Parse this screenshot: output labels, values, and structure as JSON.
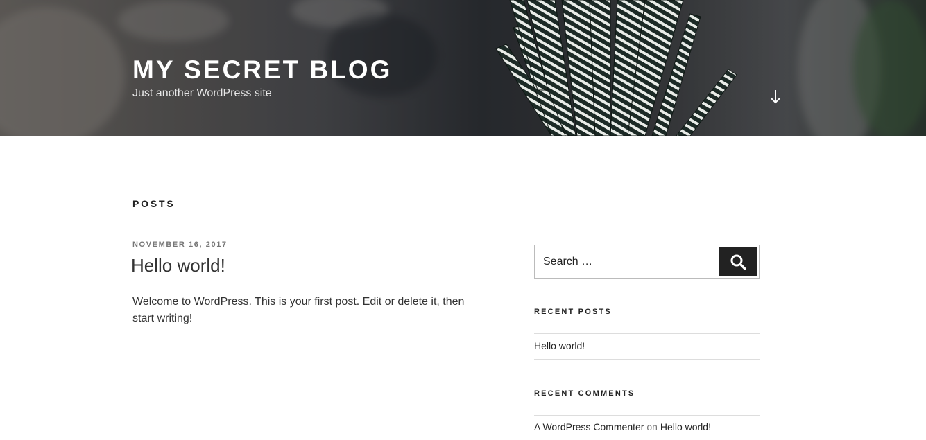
{
  "header": {
    "site_title": "MY SECRET BLOG",
    "tagline": "Just another WordPress site",
    "scroll_icon": "arrow-down-icon"
  },
  "main": {
    "heading": "POSTS",
    "posts": [
      {
        "date": "NOVEMBER 16, 2017",
        "title": "Hello world!",
        "excerpt": "Welcome to WordPress. This is your first post. Edit or delete it, then start writing!"
      }
    ]
  },
  "sidebar": {
    "search": {
      "placeholder": "Search …",
      "button_icon": "search-icon"
    },
    "recent_posts": {
      "title": "RECENT POSTS",
      "items": [
        "Hello world!"
      ]
    },
    "recent_comments": {
      "title": "RECENT COMMENTS",
      "items": [
        {
          "author": "A WordPress Commenter",
          "connector": "on",
          "post": "Hello world!"
        }
      ]
    }
  },
  "colors": {
    "text": "#222222",
    "meta": "#767676",
    "rule": "#dddddd",
    "button": "#222222"
  }
}
